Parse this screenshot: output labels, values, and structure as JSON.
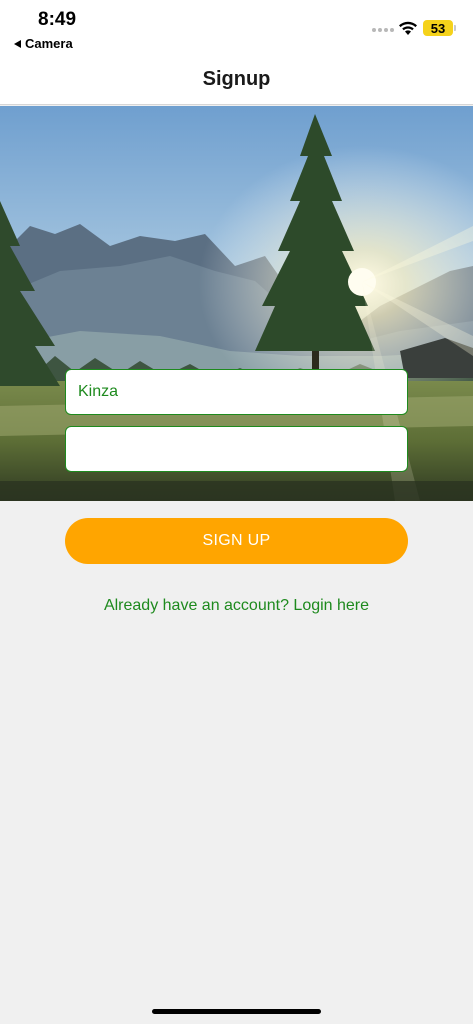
{
  "status_bar": {
    "time": "8:49",
    "back_label": "Camera",
    "battery_level": "53",
    "battery_color": "#f5d21b"
  },
  "header": {
    "title": "Signup"
  },
  "hero": {
    "icon": "landscape-photo"
  },
  "form": {
    "name_value": "Kinza",
    "second_value": "",
    "signup_label": "SIGN UP",
    "login_link": "Already have an account? Login here"
  },
  "colors": {
    "accent_green": "#1e8a1e",
    "button_orange": "#ffa500",
    "background": "#f0f0f0"
  }
}
